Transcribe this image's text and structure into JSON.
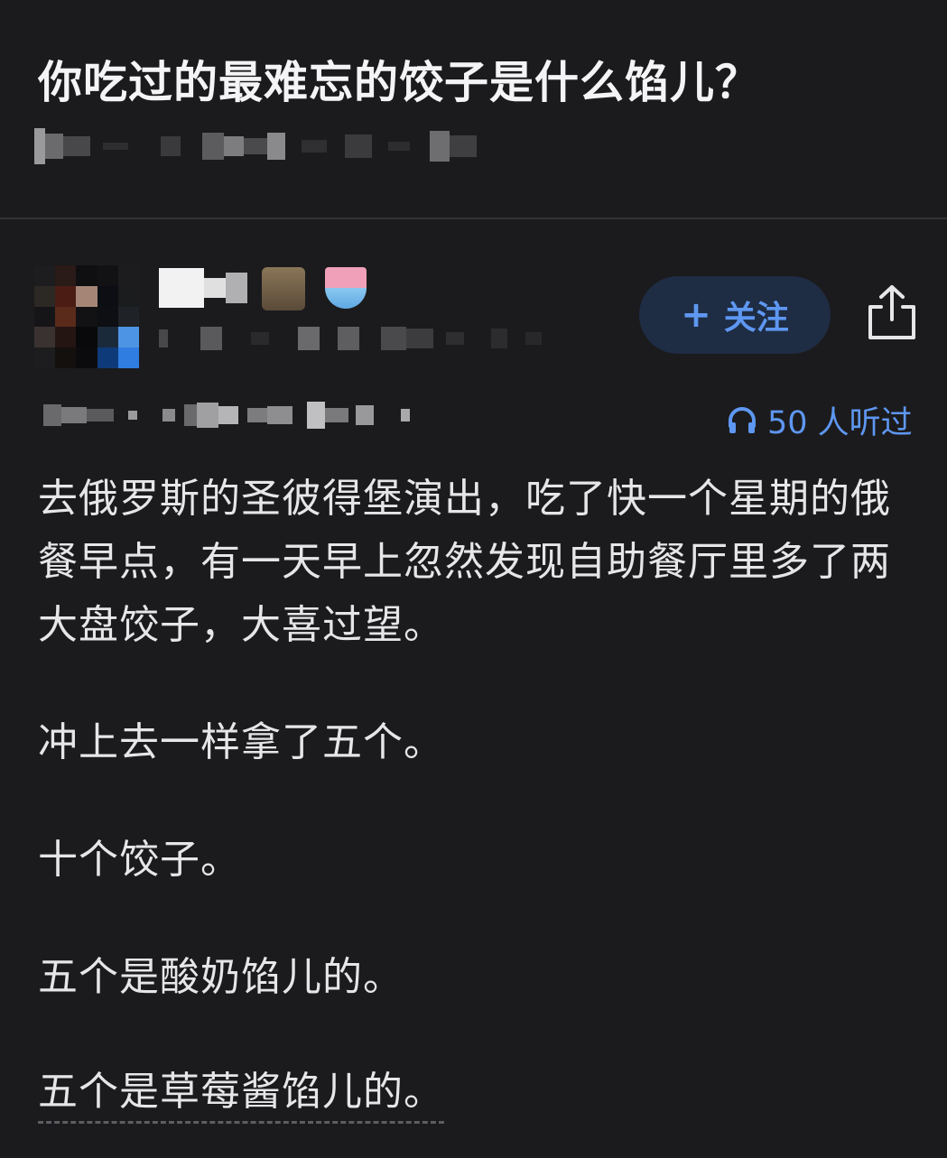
{
  "question": {
    "title": "你吃过的最难忘的饺子是什么馅儿？"
  },
  "author_actions": {
    "follow_label": "关注",
    "share_icon": "share-icon"
  },
  "listen_stat": {
    "count_text": "50 人听过",
    "icon": "headphones-icon"
  },
  "answer": {
    "paragraphs": [
      "去俄罗斯的圣彼得堡演出，吃了快一个星期的俄餐早点，有一天早上忽然发现自助餐厅里多了两大盘饺子，大喜过望。",
      "冲上去一样拿了五个。",
      "十个饺子。",
      "五个是酸奶馅儿的。",
      "五个是草莓酱馅儿的。"
    ]
  },
  "colors": {
    "background": "#1b1b1d",
    "accent": "#5e97f1",
    "follow_bg": "#1e2c44",
    "text": "#e6e6e8"
  }
}
